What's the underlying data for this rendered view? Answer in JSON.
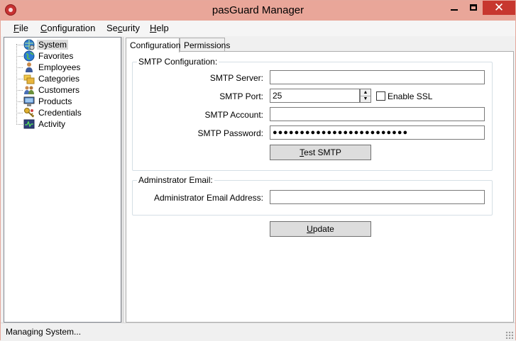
{
  "window": {
    "title": "pasGuard Manager",
    "close_glyph": "✕"
  },
  "menu": [
    {
      "mnemonic": "F",
      "rest": "ile"
    },
    {
      "mnemonic": "C",
      "rest": "onfiguration"
    },
    {
      "mnemonic": "S",
      "pre": "",
      "rest": "ecurity"
    },
    {
      "mnemonic": "H",
      "rest": "elp"
    }
  ],
  "menu_security": {
    "pre": "Se",
    "mnemonic": "c",
    "rest": "urity"
  },
  "tree": {
    "items": [
      {
        "label": "System",
        "icon": "globe-gear-icon",
        "selected": true
      },
      {
        "label": "Favorites",
        "icon": "globe-icon"
      },
      {
        "label": "Employees",
        "icon": "person-icon"
      },
      {
        "label": "Categories",
        "icon": "folders-icon"
      },
      {
        "label": "Customers",
        "icon": "people-icon"
      },
      {
        "label": "Products",
        "icon": "computer-icon"
      },
      {
        "label": "Credentials",
        "icon": "key-icon"
      },
      {
        "label": "Activity",
        "icon": "activity-monitor-icon"
      }
    ]
  },
  "tabs": [
    {
      "label": "Configuration",
      "active": true
    },
    {
      "label": "Permissions",
      "active": false
    }
  ],
  "smtp": {
    "group_title": "SMTP Configuration:",
    "server_label": "SMTP Server:",
    "server_value": "",
    "port_label": "SMTP Port:",
    "port_value": "25",
    "ssl_label": "Enable SSL",
    "ssl_checked": false,
    "account_label": "SMTP Account:",
    "account_value": "",
    "password_label": "SMTP Password:",
    "password_value": "●●●●●●●●●●●●●●●●●●●●●●●●●",
    "test_button": {
      "mnemonic": "T",
      "rest": "est SMTP"
    }
  },
  "admin": {
    "group_title": "Adminstrator Email:",
    "email_label": "Administrator Email Address:",
    "email_value": ""
  },
  "update_button": {
    "mnemonic": "U",
    "rest": "pdate"
  },
  "status": {
    "text": "Managing System..."
  },
  "colors": {
    "titlebar": "#e9a699",
    "close_button": "#c7372f",
    "window_bg": "#f0f0f0"
  }
}
